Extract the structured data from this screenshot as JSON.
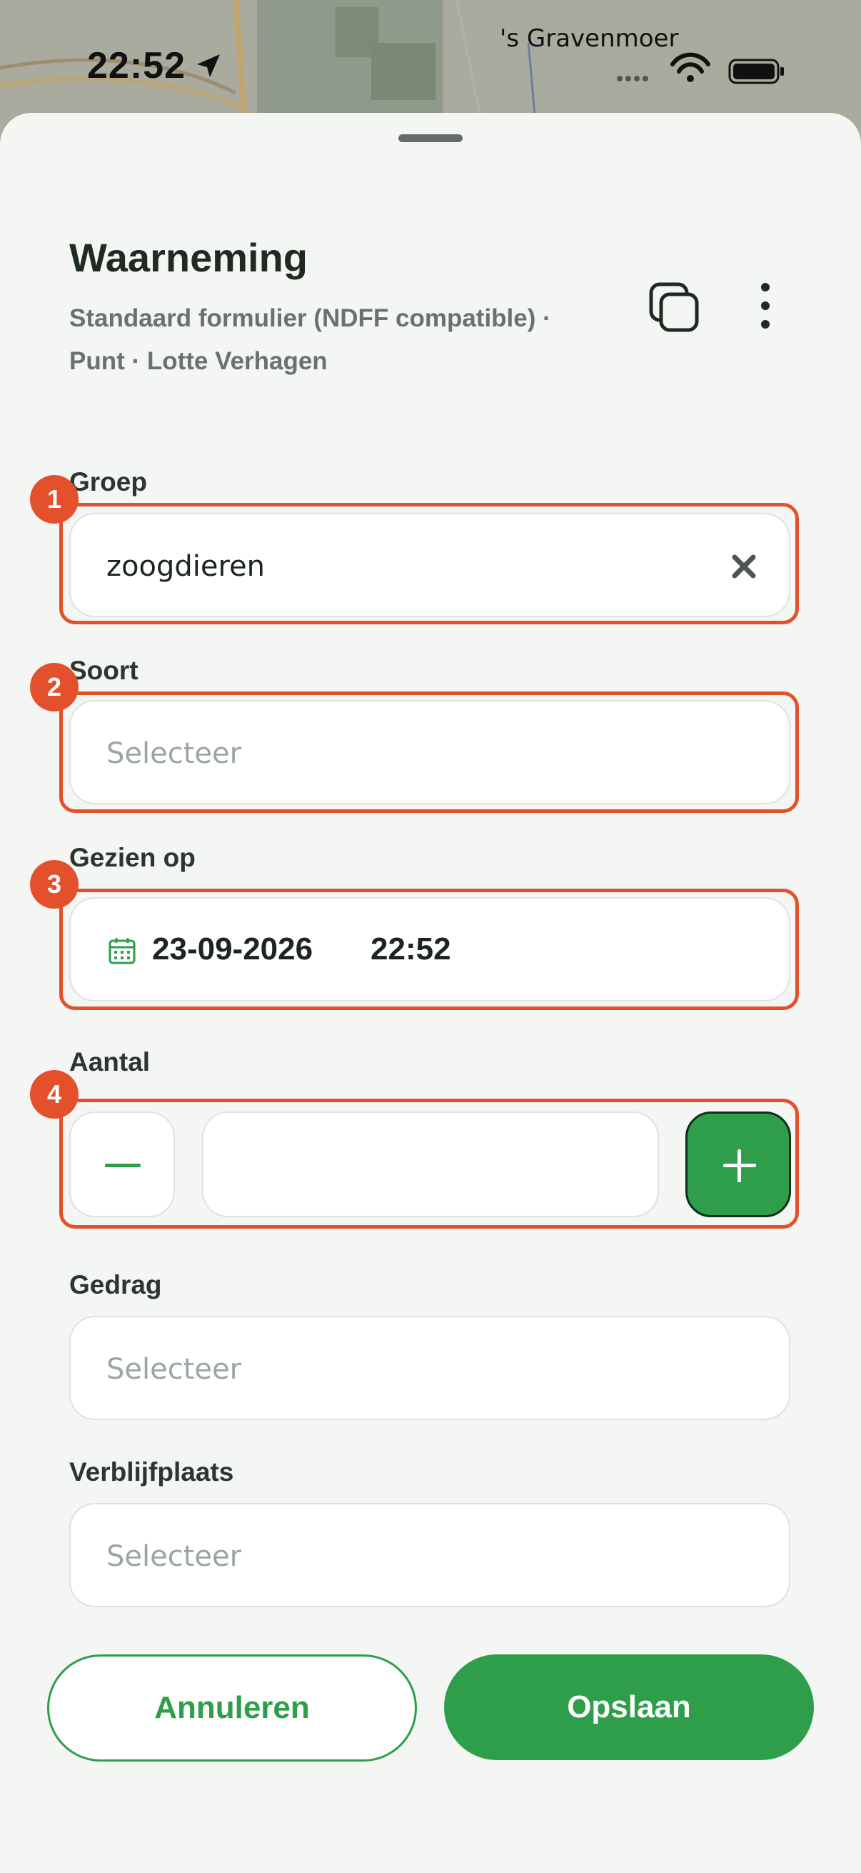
{
  "status_bar": {
    "time": "22:52",
    "map_label": "'s Gravenmoer"
  },
  "header": {
    "title": "Waarneming",
    "subtitle": "Standaard formulier (NDFF compatible) · Punt · Lotte Verhagen"
  },
  "fields": {
    "groep": {
      "label": "Groep",
      "value": "zoogdieren",
      "badge": "1"
    },
    "soort": {
      "label": "Soort",
      "placeholder": "Selecteer",
      "badge": "2"
    },
    "gezien_op": {
      "label": "Gezien op",
      "date": "23-09-2026",
      "time": "22:52",
      "badge": "3"
    },
    "aantal": {
      "label": "Aantal",
      "value": "",
      "badge": "4"
    },
    "gedrag": {
      "label": "Gedrag",
      "placeholder": "Selecteer"
    },
    "verblijfplaats": {
      "label": "Verblijfplaats",
      "placeholder": "Selecteer"
    }
  },
  "actions": {
    "cancel": "Annuleren",
    "save": "Opslaan"
  },
  "colors": {
    "accent_green": "#2e9e4a",
    "highlight": "#e4502c",
    "sheet_bg": "#f4f6f4",
    "text_dark": "#1e2a22",
    "placeholder": "#9aa79f"
  }
}
